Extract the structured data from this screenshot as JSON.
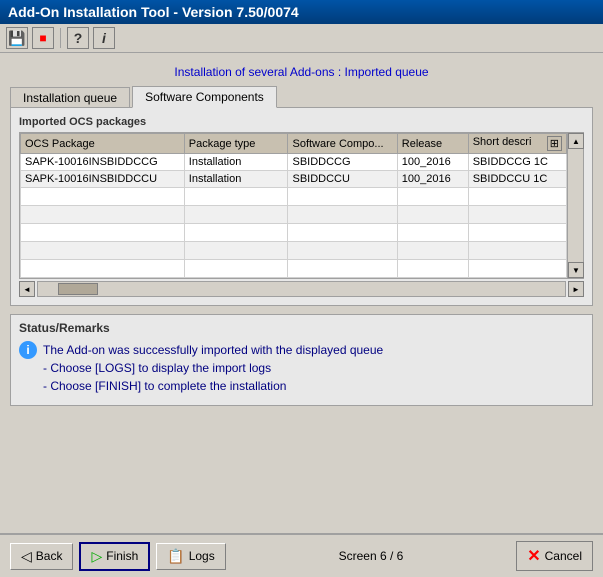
{
  "titleBar": {
    "label": "Add-On Installation Tool - Version 7.50/0074"
  },
  "toolbar": {
    "icons": [
      {
        "name": "save-icon",
        "symbol": "💾"
      },
      {
        "name": "stop-icon",
        "symbol": "🟥"
      },
      {
        "name": "help-icon",
        "symbol": "❓"
      },
      {
        "name": "info-icon",
        "symbol": "ℹ️"
      }
    ]
  },
  "subtitle": "Installation of several Add-ons : Imported queue",
  "tabs": [
    {
      "id": "installation-queue",
      "label": "Installation queue",
      "active": false
    },
    {
      "id": "software-components",
      "label": "Software Components",
      "active": true
    }
  ],
  "table": {
    "sectionLabel": "Imported OCS packages",
    "columns": [
      {
        "id": "ocs-package",
        "label": "OCS Package"
      },
      {
        "id": "package-type",
        "label": "Package type"
      },
      {
        "id": "software-comp",
        "label": "Software Compo..."
      },
      {
        "id": "release",
        "label": "Release"
      },
      {
        "id": "short-descr",
        "label": "Short descri"
      }
    ],
    "rows": [
      {
        "ocs_package": "SAPK-10016INSBIDDCCG",
        "package_type": "Installation",
        "software_comp": "SBIDDCCG",
        "release": "100_2016",
        "short_descr": "SBIDDCCG 1C"
      },
      {
        "ocs_package": "SAPK-10016INSBIDDCCU",
        "package_type": "Installation",
        "software_comp": "SBIDDCCU",
        "release": "100_2016",
        "short_descr": "SBIDDCCU 1C"
      }
    ],
    "emptyRows": 5
  },
  "statusArea": {
    "title": "Status/Remarks",
    "messages": [
      "The Add-on was successfully imported with the displayed queue",
      "- Choose [LOGS] to display the import logs",
      "- Choose [FINISH] to complete the installation"
    ]
  },
  "footer": {
    "backLabel": "Back",
    "finishLabel": "Finish",
    "logsLabel": "Logs",
    "screenInfo": "Screen 6 / 6",
    "cancelLabel": "Cancel"
  }
}
